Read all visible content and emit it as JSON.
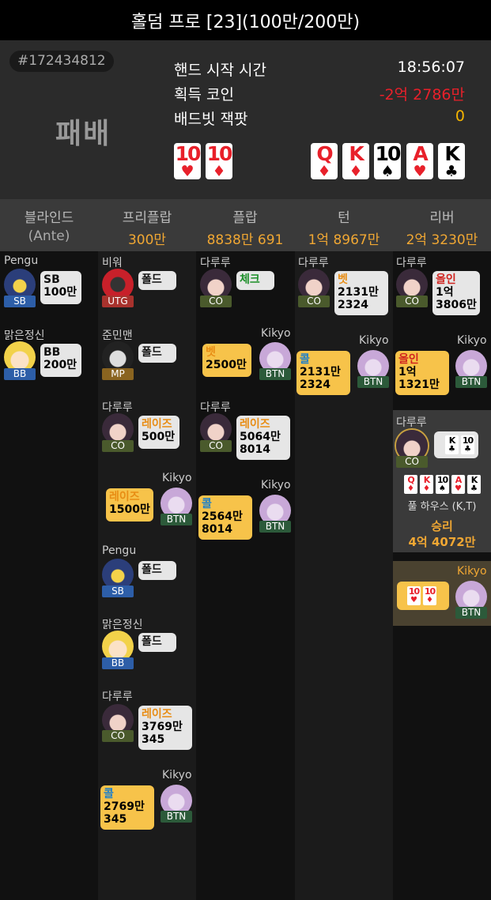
{
  "title": "홀덤 프로 [23](100만/200만)",
  "summary": {
    "hand_id": "#172434812",
    "result": "패배",
    "rows": [
      {
        "label": "핸드 시작 시간",
        "value": "18:56:07",
        "color": "#ffffff"
      },
      {
        "label": "획득 코인",
        "value": "-2억 2786만",
        "color": "#e8202a"
      },
      {
        "label": "배드빗 잭팟",
        "value": "0",
        "color": "#f5b400"
      }
    ],
    "hole_cards": [
      {
        "rank": "10",
        "suit": "♥",
        "color": "red"
      },
      {
        "rank": "10",
        "suit": "♦",
        "color": "red"
      }
    ],
    "board": [
      {
        "rank": "Q",
        "suit": "♦",
        "color": "red"
      },
      {
        "rank": "K",
        "suit": "♦",
        "color": "red"
      },
      {
        "rank": "10",
        "suit": "♠",
        "color": "blk"
      },
      {
        "rank": "A",
        "suit": "♥",
        "color": "red"
      },
      {
        "rank": "K",
        "suit": "♣",
        "color": "blk"
      }
    ]
  },
  "streets": [
    {
      "name": "블라인드",
      "pot": "(Ante)",
      "pot_gray": true
    },
    {
      "name": "프리플랍",
      "pot": "300만"
    },
    {
      "name": "플랍",
      "pot": "8838만 691"
    },
    {
      "name": "턴",
      "pot": "1억 8967만"
    },
    {
      "name": "리버",
      "pot": "2억 3230만"
    }
  ],
  "actions": {
    "blind": [
      {
        "player": "Pengu",
        "pos": "SB",
        "act": "SB",
        "amount": "100만",
        "cls": "a-fold"
      },
      {
        "player": "맑은정신",
        "pos": "BB",
        "act": "BB",
        "amount": "200만",
        "cls": "a-fold"
      }
    ],
    "preflop": [
      {
        "player": "비워",
        "pos": "UTG",
        "act": "폴드"
      },
      {
        "player": "준민맨",
        "pos": "MP",
        "act": "폴드"
      },
      {
        "player": "다루루",
        "pos": "CO",
        "act": "레이즈",
        "amount": "500만"
      },
      {
        "player": "Kikyo",
        "pos": "BTN",
        "act": "레이즈",
        "amount": "1500만"
      },
      {
        "player": "Pengu",
        "pos": "SB",
        "act": "폴드"
      },
      {
        "player": "맑은정신",
        "pos": "BB",
        "act": "폴드"
      },
      {
        "player": "다루루",
        "pos": "CO",
        "act": "레이즈",
        "amount": "3769만",
        "amount2": "345"
      },
      {
        "player": "Kikyo",
        "pos": "BTN",
        "act": "콜",
        "amount": "2769만",
        "amount2": "345"
      }
    ],
    "flop": [
      {
        "player": "다루루",
        "pos": "CO",
        "act": "체크"
      },
      {
        "player": "Kikyo",
        "pos": "BTN",
        "act": "벳",
        "amount": "2500만"
      },
      {
        "player": "다루루",
        "pos": "CO",
        "act": "레이즈",
        "amount": "5064만",
        "amount2": "8014"
      },
      {
        "player": "Kikyo",
        "pos": "BTN",
        "act": "콜",
        "amount": "2564만",
        "amount2": "8014"
      }
    ],
    "turn": [
      {
        "player": "다루루",
        "pos": "CO",
        "act": "벳",
        "amount": "2131만",
        "amount2": "2324"
      },
      {
        "player": "Kikyo",
        "pos": "BTN",
        "act": "콜",
        "amount": "2131만",
        "amount2": "2324"
      }
    ],
    "river": [
      {
        "player": "다루루",
        "pos": "CO",
        "act": "올인",
        "amount": "1억",
        "amount2": "3806만"
      },
      {
        "player": "Kikyo",
        "pos": "BTN",
        "act": "올인",
        "amount": "1억",
        "amount2": "1321만"
      }
    ]
  },
  "showdown": {
    "winner": {
      "player": "다루루",
      "pos": "CO",
      "cards": [
        {
          "rank": "K",
          "suit": "♣",
          "color": "blk"
        },
        {
          "rank": "10",
          "suit": "♣",
          "color": "blk"
        }
      ],
      "best": [
        {
          "rank": "Q",
          "suit": "♦",
          "color": "red"
        },
        {
          "rank": "K",
          "suit": "♦",
          "color": "red"
        },
        {
          "rank": "10",
          "suit": "♠",
          "color": "blk"
        },
        {
          "rank": "A",
          "suit": "♥",
          "color": "red"
        },
        {
          "rank": "K",
          "suit": "♣",
          "color": "blk"
        }
      ],
      "hand_name": "풀 하우스 (K,T)",
      "result": "승리",
      "amount": "4억 4072만"
    },
    "loser": {
      "player": "Kikyo",
      "pos": "BTN",
      "cards": [
        {
          "rank": "10",
          "suit": "♥",
          "color": "red"
        },
        {
          "rank": "10",
          "suit": "♦",
          "color": "red"
        }
      ]
    }
  }
}
